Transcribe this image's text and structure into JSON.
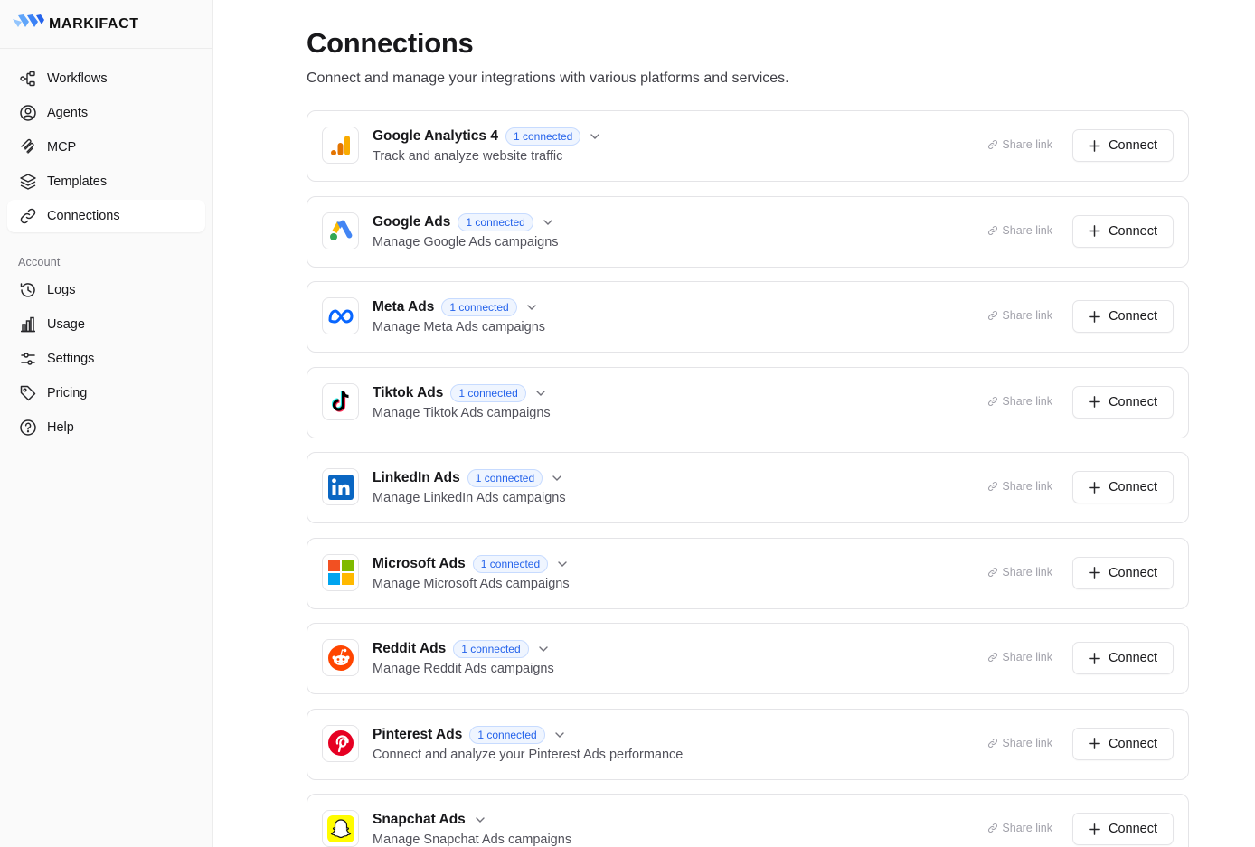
{
  "brand": {
    "name": "MARKIFACT"
  },
  "sidebar": {
    "items": [
      {
        "label": "Workflows",
        "icon": "workflow-icon"
      },
      {
        "label": "Agents",
        "icon": "agent-icon"
      },
      {
        "label": "MCP",
        "icon": "mcp-icon"
      },
      {
        "label": "Templates",
        "icon": "layers-icon"
      },
      {
        "label": "Connections",
        "icon": "link-icon",
        "active": true
      }
    ],
    "section_label": "Account",
    "account_items": [
      {
        "label": "Logs",
        "icon": "history-icon"
      },
      {
        "label": "Usage",
        "icon": "bar-chart-icon"
      },
      {
        "label": "Settings",
        "icon": "sliders-icon"
      },
      {
        "label": "Pricing",
        "icon": "tag-icon"
      },
      {
        "label": "Help",
        "icon": "help-circle-icon"
      }
    ]
  },
  "page": {
    "title": "Connections",
    "description": "Connect and manage your integrations with various platforms and services."
  },
  "labels": {
    "share_link": "Share link",
    "connect": "Connect"
  },
  "colors": {
    "accent": "#2563eb",
    "badge_bg": "#eff5ff"
  },
  "connections": [
    {
      "name": "Google Analytics 4",
      "badge": "1 connected",
      "description": "Track and analyze website traffic",
      "logo": "google-analytics-logo"
    },
    {
      "name": "Google Ads",
      "badge": "1 connected",
      "description": "Manage Google Ads campaigns",
      "logo": "google-ads-logo"
    },
    {
      "name": "Meta Ads",
      "badge": "1 connected",
      "description": "Manage Meta Ads campaigns",
      "logo": "meta-logo"
    },
    {
      "name": "Tiktok Ads",
      "badge": "1 connected",
      "description": "Manage Tiktok Ads campaigns",
      "logo": "tiktok-logo"
    },
    {
      "name": "LinkedIn Ads",
      "badge": "1 connected",
      "description": "Manage LinkedIn Ads campaigns",
      "logo": "linkedin-logo"
    },
    {
      "name": "Microsoft Ads",
      "badge": "1 connected",
      "description": "Manage Microsoft Ads campaigns",
      "logo": "microsoft-logo"
    },
    {
      "name": "Reddit Ads",
      "badge": "1 connected",
      "description": "Manage Reddit Ads campaigns",
      "logo": "reddit-logo"
    },
    {
      "name": "Pinterest Ads",
      "badge": "1 connected",
      "description": "Connect and analyze your Pinterest Ads performance",
      "logo": "pinterest-logo"
    },
    {
      "name": "Snapchat Ads",
      "badge": "",
      "description": "Manage Snapchat Ads campaigns",
      "logo": "snapchat-logo"
    }
  ]
}
